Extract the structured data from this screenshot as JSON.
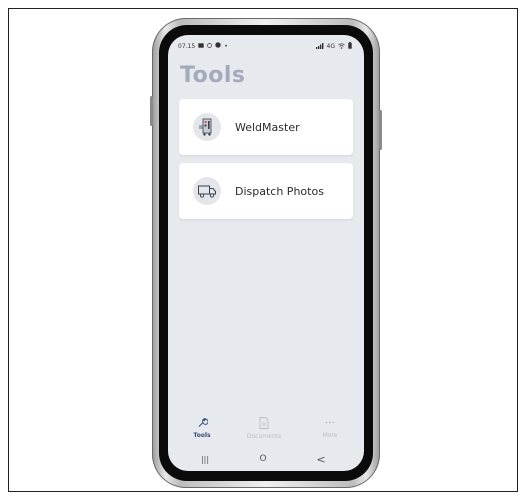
{
  "status_bar": {
    "time": "07.15",
    "right_indicators": "4G"
  },
  "screen": {
    "title": "Tools"
  },
  "tools": [
    {
      "label": "WeldMaster",
      "icon": "welding-machine-icon"
    },
    {
      "label": "Dispatch Photos",
      "icon": "truck-icon"
    }
  ],
  "bottom_nav": {
    "items": [
      {
        "label": "Tools",
        "icon": "wrench-icon",
        "active": true
      },
      {
        "label": "Documents",
        "icon": "document-icon",
        "active": false
      },
      {
        "label": "More",
        "icon": "more-dots-icon",
        "active": false
      }
    ]
  },
  "system_nav": {
    "recents": "|||",
    "home": "O",
    "back": "<"
  },
  "colors": {
    "screen_bg": "#e6e9ee",
    "title": "#a4aabb",
    "active_nav": "#3b4a7a",
    "inactive_nav": "#b8bcc6"
  }
}
